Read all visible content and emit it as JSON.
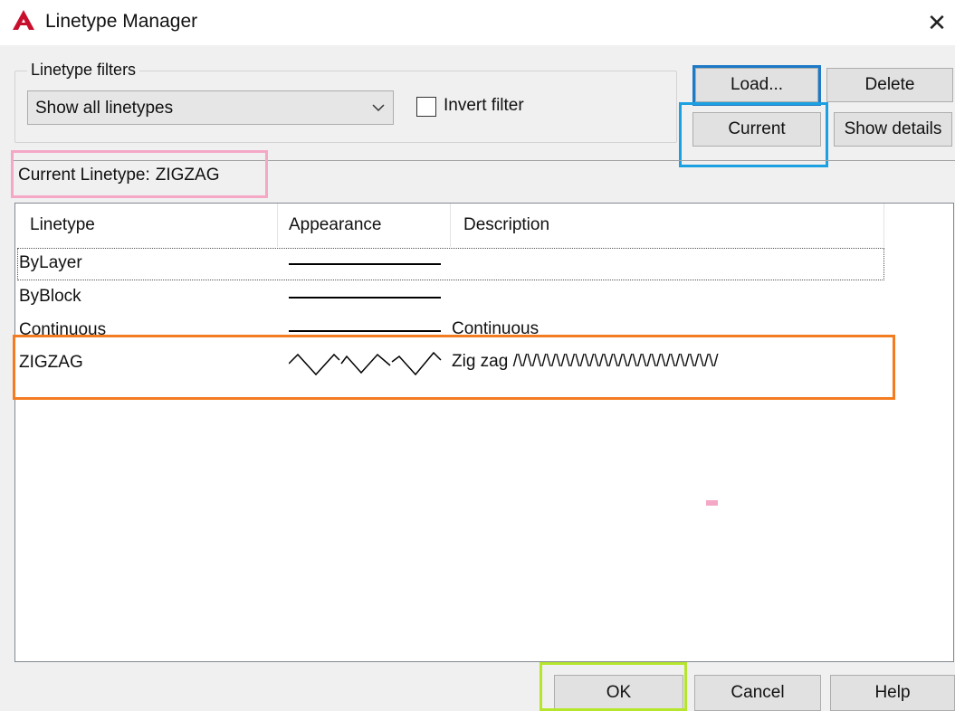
{
  "window": {
    "title": "Linetype Manager",
    "close_glyph": "✕",
    "logo_icon": "autocad-logo-icon",
    "logo_color": "#c8102e"
  },
  "filters": {
    "legend": "Linetype filters",
    "selected": "Show all linetypes",
    "invert_label": "Invert filter",
    "invert_checked": false
  },
  "buttons": {
    "load": "Load...",
    "delete": "Delete",
    "current": "Current",
    "show_details": "Show details",
    "ok": "OK",
    "cancel": "Cancel",
    "help": "Help"
  },
  "current_linetype": {
    "label": "Current Linetype:",
    "value": "ZIGZAG"
  },
  "table": {
    "columns": [
      "Linetype",
      "Appearance",
      "Description"
    ],
    "rows": [
      {
        "name": "ByLayer",
        "appearance": "solid",
        "description": ""
      },
      {
        "name": "ByBlock",
        "appearance": "solid",
        "description": ""
      },
      {
        "name": "Continuous",
        "appearance": "solid",
        "description": "Continuous"
      },
      {
        "name": "ZIGZAG",
        "appearance": "zigzag",
        "description": "Zig zag /\\/\\/\\/\\/\\/\\/\\/\\/\\/\\/\\/\\/\\/\\/\\/\\/\\/\\/\\/\\/\\/"
      }
    ]
  },
  "highlight_colors": {
    "load": "#1e7ac6",
    "current": "#1ba0e2",
    "current_linetype": "#f5a8c6",
    "zigzag_row": "#f47c20",
    "ok": "#b5e62d"
  }
}
